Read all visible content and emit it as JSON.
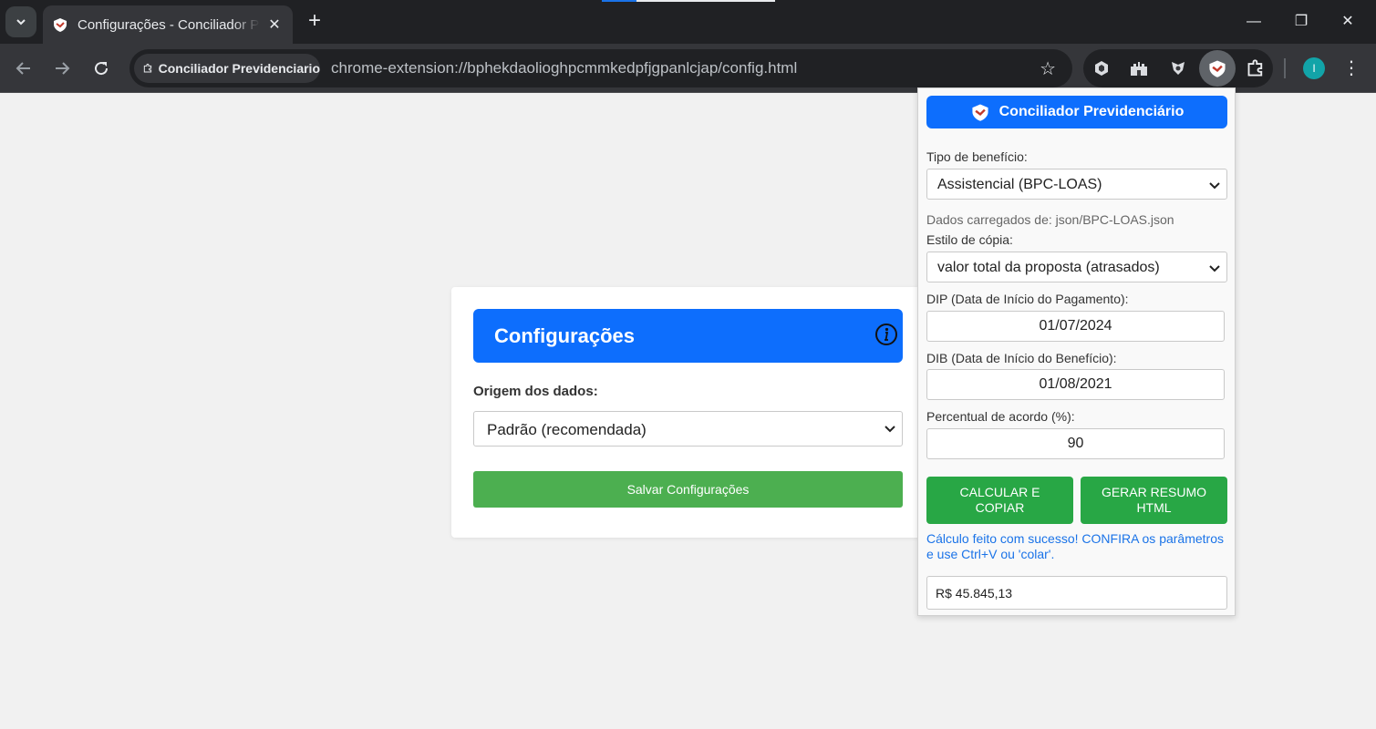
{
  "browser": {
    "tab_title": "Configurações - Conciliador Previdenciario",
    "new_tab_glyph": "+",
    "site_chip_label": "Conciliador Previdenciario",
    "url": "chrome-extension://bphekdaolioghpcmmkedpfjgpanlcjap/config.html",
    "profile_initial": "I",
    "icons": [
      "tab-search-icon",
      "extension-logo-icon",
      "close-icon",
      "minimize-icon",
      "restore-icon",
      "back-icon",
      "forward-icon",
      "reload-icon",
      "extension-puzzle-icon",
      "bookmark-star-icon",
      "shield-extension-icon",
      "castle-extension-icon",
      "badge-extension-icon",
      "conciliador-extension-icon",
      "menu-icon"
    ]
  },
  "config_page": {
    "title": "Configurações",
    "origem_label": "Origem dos dados:",
    "origem_selected": "Padrão (recomendada)",
    "save_button": "Salvar Configurações"
  },
  "popup": {
    "title": "Conciliador Previdenciário",
    "tipo_beneficio_label": "Tipo de benefício:",
    "tipo_beneficio_selected": "Assistencial (BPC-LOAS)",
    "dados_info": "Dados carregados de: json/BPC-LOAS.json",
    "estilo_copia_label": "Estilo de cópia:",
    "estilo_copia_selected": "valor total da proposta (atrasados)",
    "dip_label": "DIP (Data de Início do Pagamento):",
    "dip_value": "01/07/2024",
    "dib_label": "DIB (Data de Início do Benefício):",
    "dib_value": "01/08/2021",
    "percentual_label": "Percentual de acordo (%):",
    "percentual_value": "90",
    "calcular_button": "CALCULAR E COPIAR",
    "gerar_button": "GERAR RESUMO HTML",
    "success_message": "Cálculo feito com sucesso! CONFIRA os parâmetros e use Ctrl+V ou 'colar'.",
    "result_value": "R$ 45.845,13"
  },
  "colors": {
    "primary_blue": "#0d6efd",
    "save_green": "#4caf50",
    "action_green": "#28a745",
    "success_text": "#1a73e8",
    "chrome_dark": "#202124"
  }
}
